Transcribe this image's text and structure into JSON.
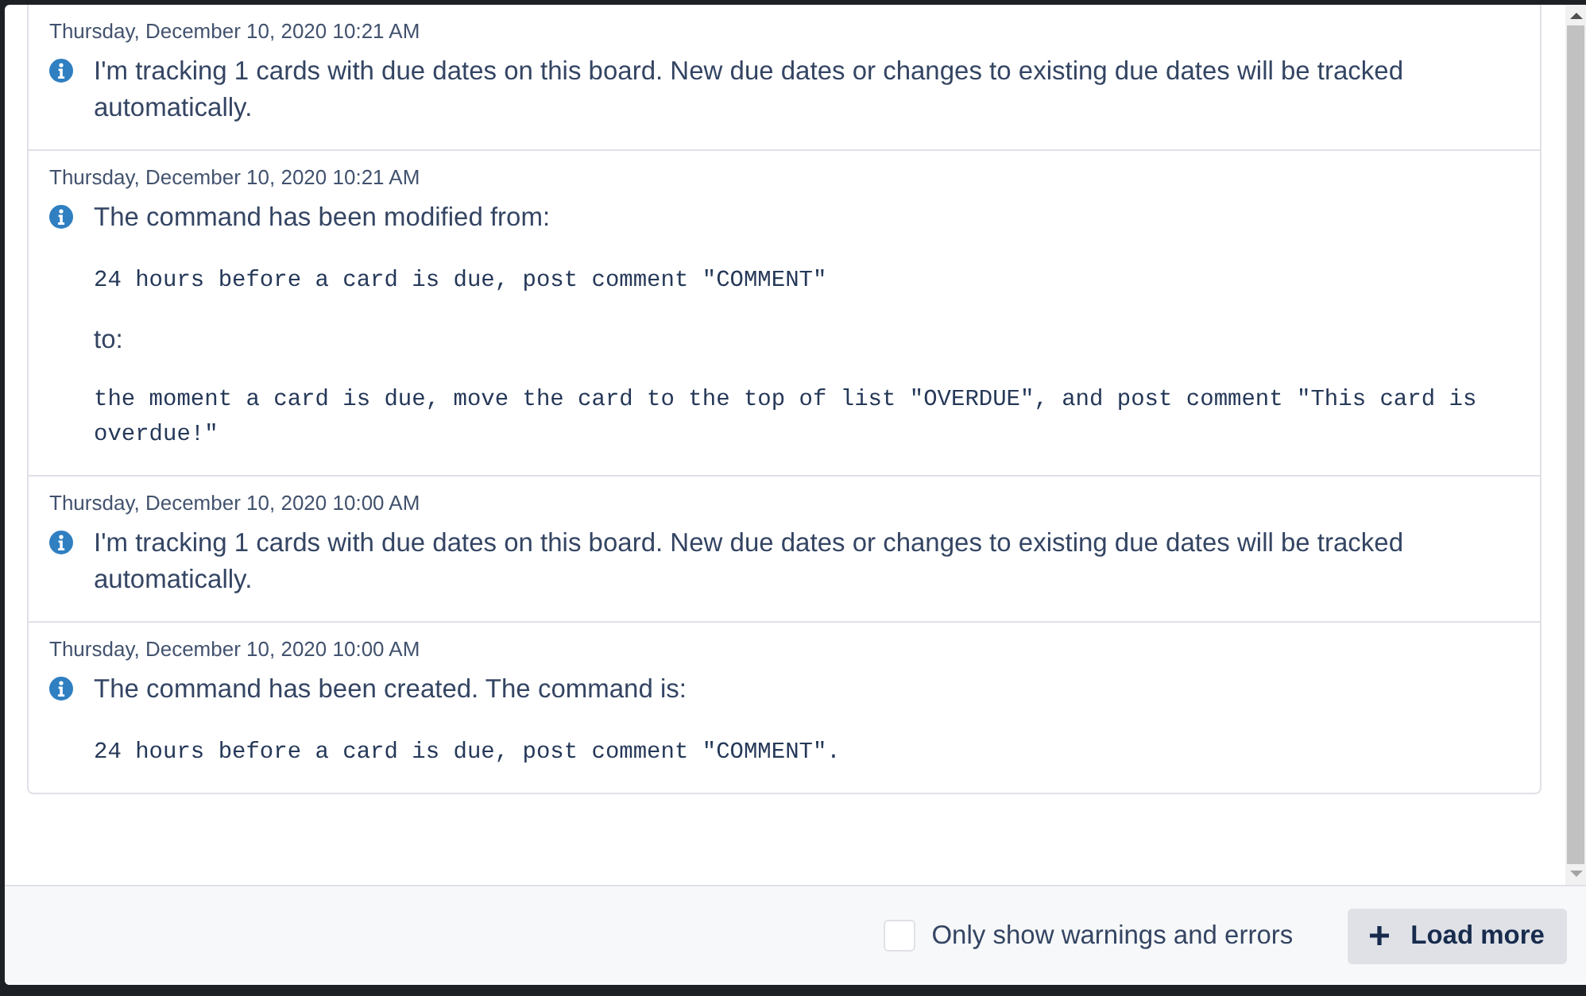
{
  "entries": [
    {
      "timestamp": "Thursday, December 10, 2020 10:21 AM",
      "blocks": [
        {
          "kind": "text",
          "text": "I'm tracking 1 cards with due dates on this board. New due dates or changes to existing due dates will be tracked automatically."
        }
      ]
    },
    {
      "timestamp": "Thursday, December 10, 2020 10:21 AM",
      "blocks": [
        {
          "kind": "text",
          "text": "The command has been modified from:"
        },
        {
          "kind": "code",
          "text": "24 hours before a card is due, post comment \"COMMENT\""
        },
        {
          "kind": "plain",
          "text": "to:"
        },
        {
          "kind": "code",
          "text": "the moment a card is due, move the card to the top of list \"OVERDUE\", and post comment \"This card is overdue!\""
        }
      ]
    },
    {
      "timestamp": "Thursday, December 10, 2020 10:00 AM",
      "blocks": [
        {
          "kind": "text",
          "text": "I'm tracking 1 cards with due dates on this board. New due dates or changes to existing due dates will be tracked automatically."
        }
      ]
    },
    {
      "timestamp": "Thursday, December 10, 2020 10:00 AM",
      "blocks": [
        {
          "kind": "text",
          "text": "The command has been created. The command is:"
        },
        {
          "kind": "code",
          "text": "24 hours before a card is due, post comment \"COMMENT\"."
        }
      ]
    }
  ],
  "footer": {
    "filter": {
      "label": "Only show warnings and errors",
      "checked": false
    },
    "load_button": {
      "label": "Load more"
    }
  }
}
